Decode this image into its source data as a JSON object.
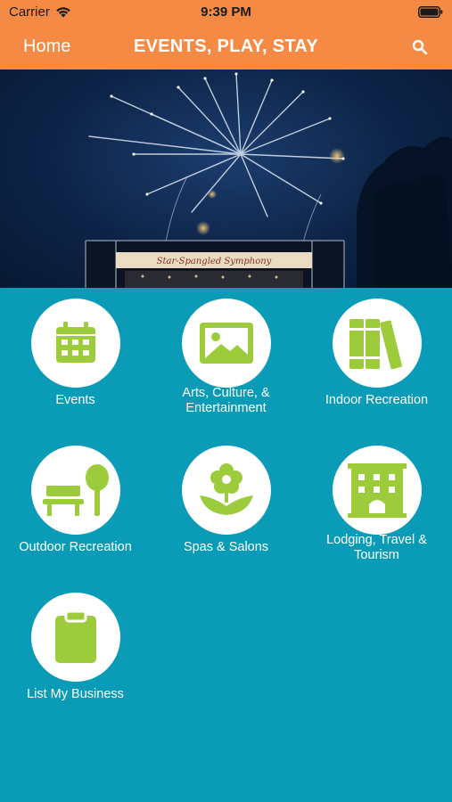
{
  "status": {
    "carrier": "Carrier",
    "time": "9:39 PM"
  },
  "nav": {
    "home_label": "Home",
    "title": "EVENTS, PLAY, STAY",
    "search_icon": "search-icon"
  },
  "hero": {
    "banner_text": "Star-Spangled Symphony"
  },
  "colors": {
    "header": "#f58a45",
    "background": "#0a9bb7",
    "icon_green": "#9ccb3b",
    "circle": "#ffffff"
  },
  "categories": [
    {
      "label": "Events",
      "icon": "calendar-icon"
    },
    {
      "label": "Arts, Culture, & Entertainment",
      "icon": "image-icon"
    },
    {
      "label": "Indoor Recreation",
      "icon": "books-icon"
    },
    {
      "label": "Outdoor Recreation",
      "icon": "park-bench-tree-icon"
    },
    {
      "label": "Spas & Salons",
      "icon": "flower-icon"
    },
    {
      "label": "Lodging, Travel & Tourism",
      "icon": "hotel-icon"
    },
    {
      "label": "List My Business",
      "icon": "clipboard-icon"
    }
  ]
}
